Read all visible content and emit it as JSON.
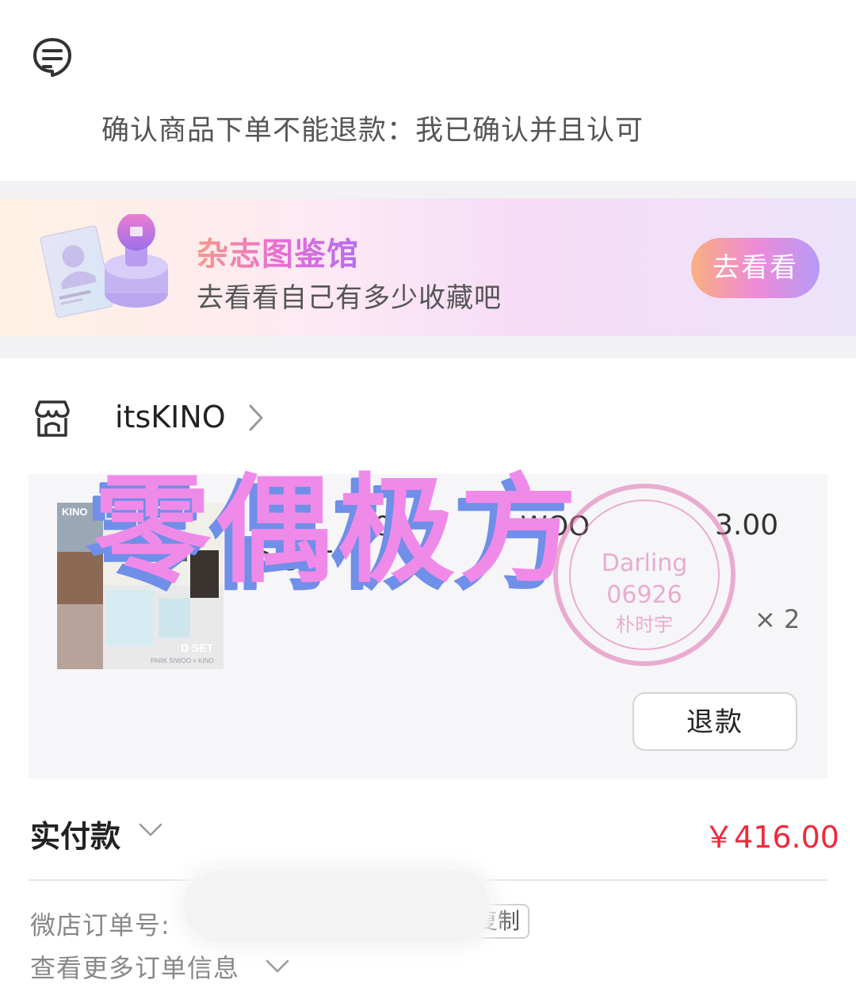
{
  "notice": {
    "icon": "chat-bubble-icon",
    "text": "确认商品下单不能退款：我已确认并且认可"
  },
  "banner": {
    "title": "杂志图鉴馆",
    "subtitle": "去看看自己有多少收藏吧",
    "button_label": "去看看",
    "art_icon": "magazine-stamp-illustration"
  },
  "store": {
    "icon": "storefront-icon",
    "name": "itsKINO"
  },
  "item": {
    "title": "KINO 06 ... WOO ... D SET",
    "title_visible_parts": [
      "K",
      "06",
      "WOO",
      "D SET"
    ],
    "price": "3.00",
    "quantity": "× 2",
    "refund_label": "退款",
    "thumbnail_labels": [
      "KINO",
      "D SET",
      "PARK SIWOO × KINO"
    ]
  },
  "payment": {
    "label": "实付款",
    "amount": "￥416.00",
    "amount_color": "#f0283c"
  },
  "order": {
    "number_label": "微店订单号:",
    "copy_label": "复制",
    "more_label": "查看更多订单信息"
  },
  "watermark": {
    "text": "零偶极方",
    "stamp_text": "Darling 06926 朴时宇"
  },
  "colors": {
    "accent_red": "#f0283c",
    "watermark_pink": "#f08ae8",
    "watermark_shadow": "#6f8fe8"
  }
}
